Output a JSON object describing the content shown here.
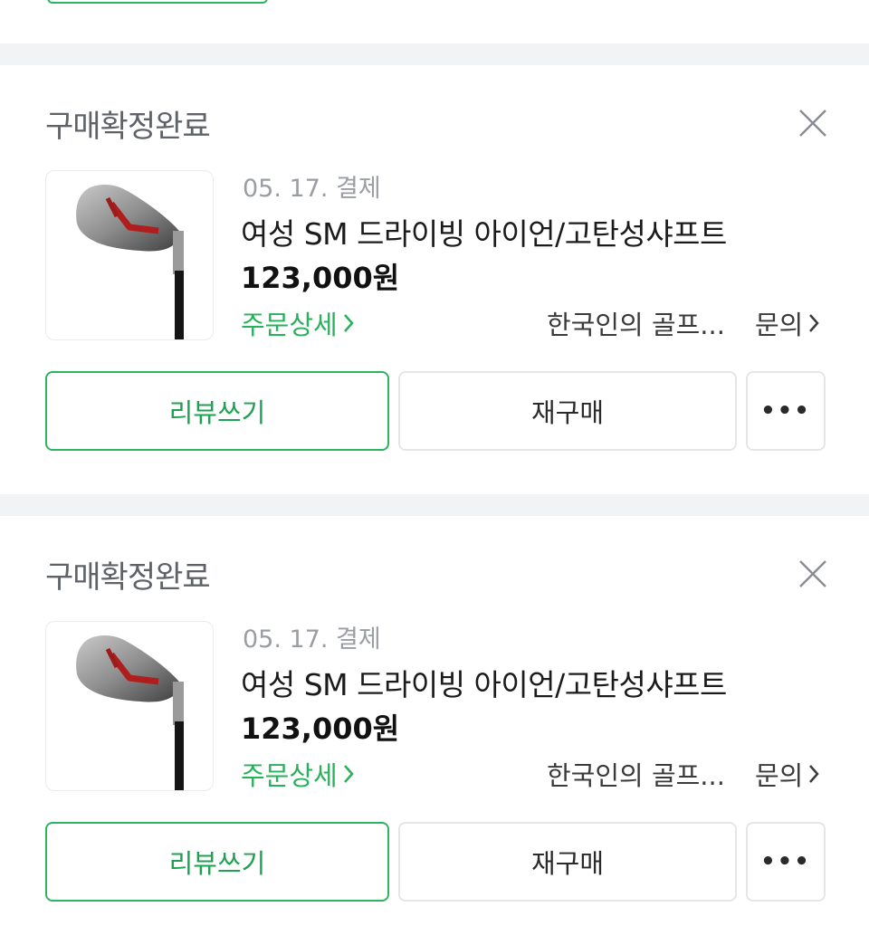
{
  "orders": [
    {
      "status": "구매확정완료",
      "date": "05. 17. 결제",
      "product_name": "여성 SM 드라이빙 아이언/고탄성샤프트",
      "price": "123,000원",
      "detail_link": "주문상세",
      "seller": "한국인의 골프...",
      "inquiry_link": "문의",
      "buttons": {
        "review": "리뷰쓰기",
        "rebuy": "재구매",
        "more": "•••"
      }
    },
    {
      "status": "구매확정완료",
      "date": "05. 17. 결제",
      "product_name": "여성 SM 드라이빙 아이언/고탄성샤프트",
      "price": "123,000원",
      "detail_link": "주문상세",
      "seller": "한국인의 골프...",
      "inquiry_link": "문의",
      "buttons": {
        "review": "리뷰쓰기",
        "rebuy": "재구매",
        "more": "•••"
      }
    }
  ],
  "icons": {
    "close": "close-icon",
    "chevron": "chevron-right-icon",
    "product": "golf-iron-club-image"
  },
  "colors": {
    "accent": "#2db45f",
    "separator": "#f1f3f5",
    "muted_text": "#9a9da2"
  }
}
